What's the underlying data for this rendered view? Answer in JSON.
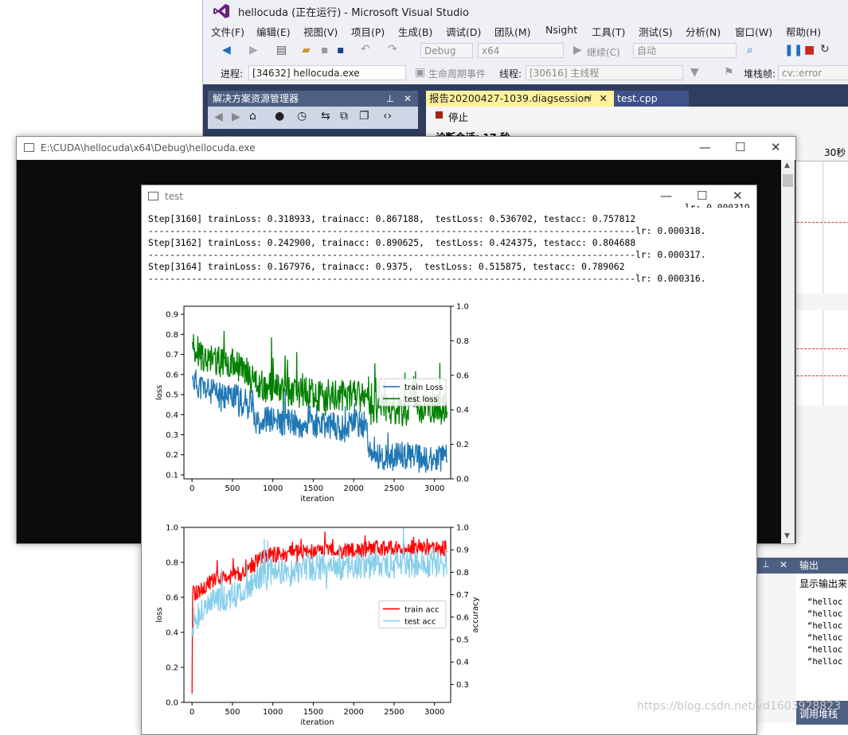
{
  "vs": {
    "title": "hellocuda (正在运行) - Microsoft Visual Studio",
    "menu": [
      "文件(F)",
      "编辑(E)",
      "视图(V)",
      "项目(P)",
      "生成(B)",
      "调试(D)",
      "团队(M)",
      "Nsight",
      "工具(T)",
      "测试(S)",
      "分析(N)",
      "窗口(W)",
      "帮助(H)"
    ],
    "toolbar": {
      "config": "Debug",
      "platform": "x64",
      "continue": "继续(C)",
      "auto": "自动"
    },
    "toolbar2": {
      "process_label": "进程:",
      "process_value": "[34632] hellocuda.exe",
      "lifecycle": "生命周期事件",
      "thread_label": "线程:",
      "thread_value": "[30616] 主线程",
      "stack_label": "堆栈帧:",
      "stack_value": "cv::error"
    },
    "solution_explorer": "解决方案资源管理器",
    "doc_tabs": [
      "报告20200427-1039.diagsession",
      "test.cpp"
    ],
    "stop_label": "停止",
    "diag_session": "诊断会话: 17 秒",
    "timeline_label": "30秒",
    "output": {
      "title": "输出",
      "show_from": "显示输出来",
      "lines": [
        "“helloc",
        "“helloc",
        "“helloc",
        "“helloc",
        "“helloc",
        "“helloc"
      ],
      "bottom_tab": "调用堆栈"
    }
  },
  "console": {
    "title": "E:\\CUDA\\hellocuda\\x64\\Debug\\hellocuda.exe"
  },
  "test": {
    "title": "test",
    "log": [
      "Step[3160] trainLoss: 0.318933, trainacc: 0.867188,  testLoss: 0.536702, testacc: 0.757812",
      "------------------------------------------------------------------------------------------lr: 0.000318.",
      "Step[3162] trainLoss: 0.242900, trainacc: 0.890625,  testLoss: 0.424375, testacc: 0.804688",
      "------------------------------------------------------------------------------------------lr: 0.000317.",
      "Step[3164] trainLoss: 0.167976, trainacc: 0.9375,  testLoss: 0.515875, testacc: 0.789062",
      "------------------------------------------------------------------------------------------lr: 0.000316."
    ],
    "partial_top": "lr: 0.000319."
  },
  "watermark": "https://blog.csdn.net/vd1603928823",
  "chart_data": [
    {
      "type": "line",
      "xlabel": "iteration",
      "ylabel": "loss",
      "xlim": [
        -100,
        3200
      ],
      "ylim": [
        0.08,
        0.94
      ],
      "y2lim": [
        0.0,
        1.0
      ],
      "xticks": [
        0,
        500,
        1000,
        1500,
        2000,
        2500,
        3000
      ],
      "yticks": [
        0.1,
        0.2,
        0.3,
        0.4,
        0.5,
        0.6,
        0.7,
        0.8,
        0.9
      ],
      "y2ticks": [
        0.0,
        0.2,
        0.4,
        0.6,
        0.8,
        1.0
      ],
      "legend_position": "right",
      "series": [
        {
          "name": "train Loss",
          "color": "#1f77b4",
          "x": [
            0,
            100,
            200,
            300,
            400,
            500,
            600,
            700,
            800,
            900,
            1000,
            1100,
            1200,
            1300,
            1400,
            1500,
            1600,
            1700,
            1800,
            1900,
            2000,
            2100,
            2150,
            2200,
            2300,
            2400,
            2500,
            2600,
            2700,
            2800,
            2900,
            3000,
            3100,
            3160
          ],
          "y": [
            0.58,
            0.54,
            0.52,
            0.5,
            0.49,
            0.5,
            0.47,
            0.45,
            0.37,
            0.38,
            0.37,
            0.36,
            0.37,
            0.35,
            0.36,
            0.35,
            0.34,
            0.35,
            0.34,
            0.33,
            0.36,
            0.35,
            0.35,
            0.19,
            0.2,
            0.19,
            0.19,
            0.19,
            0.2,
            0.18,
            0.17,
            0.18,
            0.18,
            0.18
          ]
        },
        {
          "name": "test loss",
          "color": "#008000",
          "x": [
            0,
            100,
            200,
            300,
            400,
            500,
            600,
            700,
            800,
            900,
            1000,
            1100,
            1200,
            1300,
            1400,
            1500,
            1600,
            1700,
            1800,
            1900,
            2000,
            2100,
            2150,
            2200,
            2300,
            2400,
            2500,
            2600,
            2700,
            2800,
            2900,
            3000,
            3100,
            3160
          ],
          "y": [
            0.76,
            0.7,
            0.68,
            0.67,
            0.66,
            0.66,
            0.64,
            0.6,
            0.55,
            0.54,
            0.54,
            0.52,
            0.52,
            0.5,
            0.51,
            0.5,
            0.49,
            0.5,
            0.5,
            0.49,
            0.5,
            0.49,
            0.5,
            0.42,
            0.44,
            0.42,
            0.43,
            0.42,
            0.43,
            0.42,
            0.44,
            0.43,
            0.43,
            0.45
          ]
        }
      ]
    },
    {
      "type": "line",
      "xlabel": "iteration",
      "ylabel": "loss",
      "y2label": "accuracy",
      "xlim": [
        -100,
        3200
      ],
      "ylim": [
        0.0,
        1.0
      ],
      "y2lim": [
        0.22,
        1.0
      ],
      "xticks": [
        0,
        500,
        1000,
        1500,
        2000,
        2500,
        3000
      ],
      "yticks": [
        0.0,
        0.2,
        0.4,
        0.6,
        0.8,
        1.0
      ],
      "y2ticks": [
        0.3,
        0.4,
        0.5,
        0.6,
        0.7,
        0.8,
        0.9,
        1.0
      ],
      "legend_position": "right",
      "series": [
        {
          "name": "train acc",
          "color": "#ff0000",
          "x": [
            0,
            5,
            10,
            100,
            200,
            300,
            400,
            500,
            600,
            700,
            800,
            900,
            1000,
            1100,
            1200,
            1300,
            1400,
            1500,
            1600,
            1700,
            1800,
            1900,
            2000,
            2100,
            2200,
            2300,
            2400,
            2500,
            2600,
            2700,
            2800,
            2900,
            3000,
            3100,
            3160
          ],
          "y": [
            0.05,
            0.55,
            0.62,
            0.64,
            0.68,
            0.7,
            0.71,
            0.72,
            0.74,
            0.76,
            0.81,
            0.84,
            0.84,
            0.85,
            0.85,
            0.86,
            0.86,
            0.86,
            0.87,
            0.87,
            0.87,
            0.87,
            0.87,
            0.87,
            0.88,
            0.88,
            0.88,
            0.88,
            0.88,
            0.88,
            0.89,
            0.88,
            0.89,
            0.88,
            0.88
          ]
        },
        {
          "name": "test acc",
          "color": "#87ceeb",
          "x": [
            0,
            5,
            10,
            100,
            200,
            300,
            400,
            500,
            600,
            700,
            800,
            900,
            1000,
            1100,
            1200,
            1300,
            1400,
            1500,
            1600,
            1700,
            1800,
            1900,
            2000,
            2100,
            2200,
            2300,
            2400,
            2500,
            2600,
            2700,
            2800,
            2900,
            3000,
            3100,
            3160
          ],
          "y": [
            0.38,
            0.42,
            0.45,
            0.5,
            0.55,
            0.58,
            0.6,
            0.61,
            0.63,
            0.65,
            0.7,
            0.74,
            0.75,
            0.76,
            0.76,
            0.76,
            0.77,
            0.77,
            0.77,
            0.77,
            0.77,
            0.78,
            0.78,
            0.78,
            0.78,
            0.78,
            0.78,
            0.78,
            0.78,
            0.79,
            0.79,
            0.79,
            0.79,
            0.79,
            0.79
          ]
        }
      ]
    }
  ]
}
